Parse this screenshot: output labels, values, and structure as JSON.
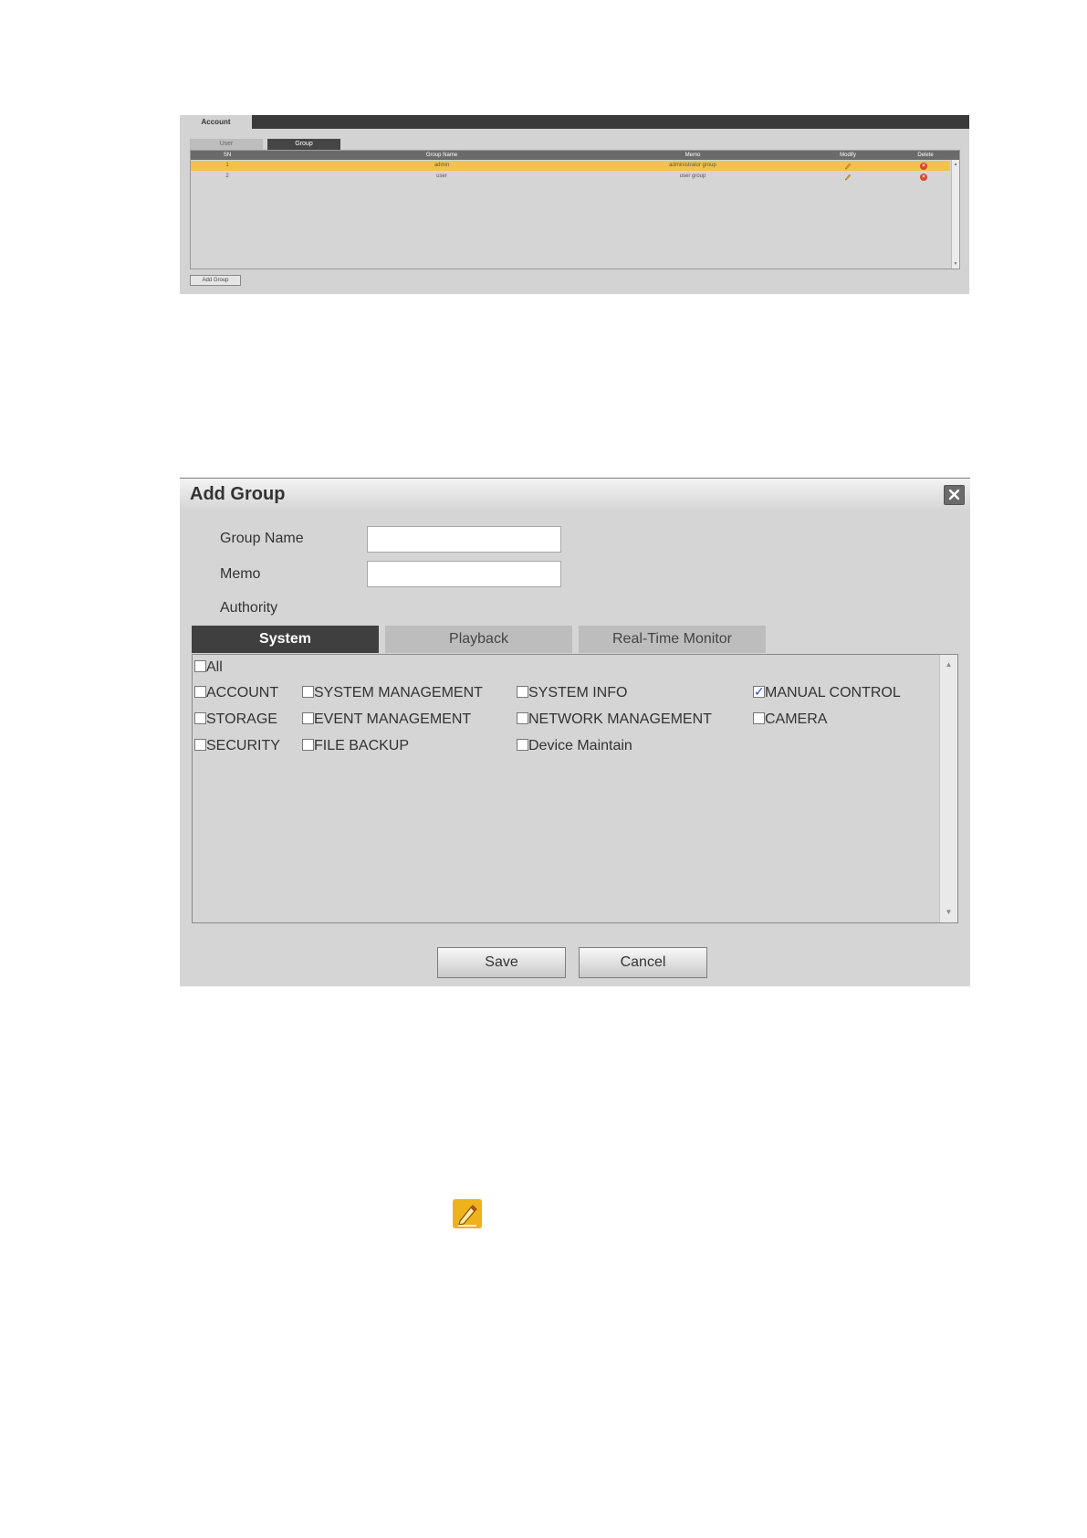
{
  "account_panel": {
    "tab_label": "Account",
    "subtabs": [
      {
        "label": "User"
      },
      {
        "label": "Group"
      }
    ],
    "columns": [
      "SN",
      "Group Name",
      "Memo",
      "Modify",
      "Delete"
    ],
    "rows": [
      {
        "sn": "1",
        "group_name": "admin",
        "memo": "administrator group",
        "selected": true
      },
      {
        "sn": "2",
        "group_name": "user",
        "memo": "user group",
        "selected": false
      }
    ],
    "add_group_label": "Add Group"
  },
  "dialog": {
    "title": "Add Group",
    "labels": {
      "group_name": "Group Name",
      "memo": "Memo",
      "authority": "Authority"
    },
    "inputs": {
      "group_name_value": "",
      "memo_value": ""
    },
    "tabs": [
      {
        "label": "System",
        "active": true
      },
      {
        "label": "Playback",
        "active": false
      },
      {
        "label": "Real-Time Monitor",
        "active": false
      }
    ],
    "permissions": {
      "all": {
        "label": "All",
        "checked": false
      },
      "items": [
        {
          "label": "ACCOUNT",
          "checked": false
        },
        {
          "label": "SYSTEM MANAGEMENT",
          "checked": false
        },
        {
          "label": "SYSTEM INFO",
          "checked": false
        },
        {
          "label": "MANUAL CONTROL",
          "checked": true
        },
        {
          "label": "STORAGE",
          "checked": false
        },
        {
          "label": "EVENT MANAGEMENT",
          "checked": false
        },
        {
          "label": "NETWORK MANAGEMENT",
          "checked": false
        },
        {
          "label": "CAMERA",
          "checked": false
        },
        {
          "label": "SECURITY",
          "checked": false
        },
        {
          "label": "FILE BACKUP",
          "checked": false
        },
        {
          "label": "Device Maintain",
          "checked": false
        }
      ]
    },
    "buttons": {
      "save": "Save",
      "cancel": "Cancel"
    }
  },
  "colors": {
    "selected_row": "#f1c34a",
    "active_tab": "#3f3f3f",
    "checkmark": "#2a49b8",
    "delete_icon": "#d9472b",
    "modify_icon": "#efb11c"
  }
}
